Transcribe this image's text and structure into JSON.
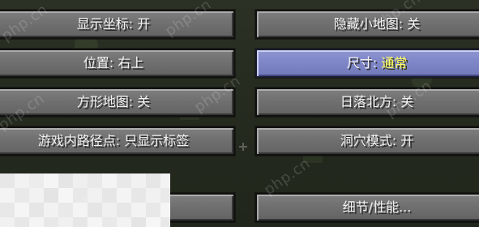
{
  "buttons": {
    "show_coords": {
      "label": "显示坐标:",
      "value": "开"
    },
    "hide_minimap": {
      "label": "隐藏小地图:",
      "value": "关"
    },
    "position": {
      "label": "位置:",
      "value": "右上"
    },
    "size": {
      "label": "尺寸:",
      "value": "通常"
    },
    "square_map": {
      "label": "方形地图:",
      "value": "关"
    },
    "sunset_north": {
      "label": "日落北方:",
      "value": "关"
    },
    "waypoint": {
      "label": "游戏内路径点:",
      "value": "只显示标签"
    },
    "cave_mode": {
      "label": "洞穴模式:",
      "value": "开"
    },
    "details": {
      "label": "细节/性能..."
    }
  },
  "watermark": "php.cn",
  "colors": {
    "button_gray": "#6e6e6e",
    "button_active": "#7b83c8",
    "active_text": "#ffff66"
  }
}
